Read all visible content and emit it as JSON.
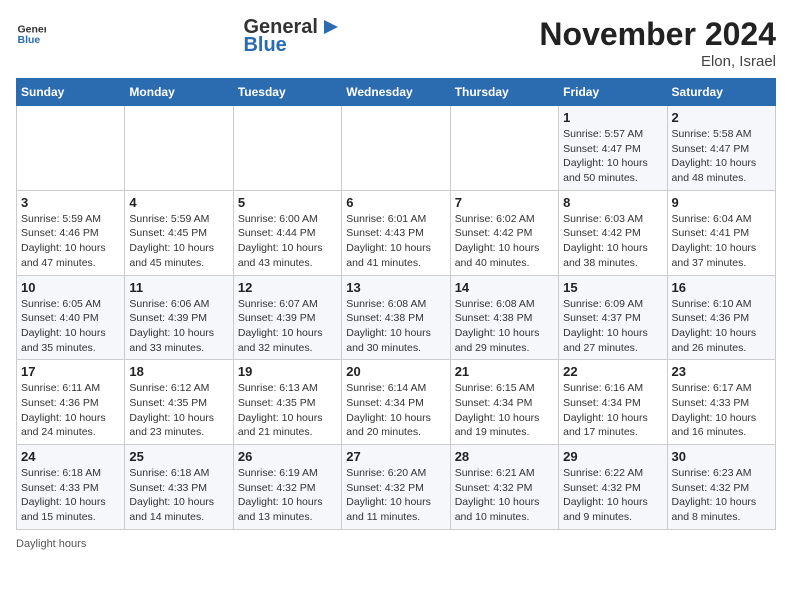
{
  "logo": {
    "general": "General",
    "blue": "Blue"
  },
  "header": {
    "month": "November 2024",
    "location": "Elon, Israel"
  },
  "days_of_week": [
    "Sunday",
    "Monday",
    "Tuesday",
    "Wednesday",
    "Thursday",
    "Friday",
    "Saturday"
  ],
  "weeks": [
    [
      {
        "day": "",
        "info": ""
      },
      {
        "day": "",
        "info": ""
      },
      {
        "day": "",
        "info": ""
      },
      {
        "day": "",
        "info": ""
      },
      {
        "day": "",
        "info": ""
      },
      {
        "day": "1",
        "info": "Sunrise: 5:57 AM\nSunset: 4:47 PM\nDaylight: 10 hours and 50 minutes."
      },
      {
        "day": "2",
        "info": "Sunrise: 5:58 AM\nSunset: 4:47 PM\nDaylight: 10 hours and 48 minutes."
      }
    ],
    [
      {
        "day": "3",
        "info": "Sunrise: 5:59 AM\nSunset: 4:46 PM\nDaylight: 10 hours and 47 minutes."
      },
      {
        "day": "4",
        "info": "Sunrise: 5:59 AM\nSunset: 4:45 PM\nDaylight: 10 hours and 45 minutes."
      },
      {
        "day": "5",
        "info": "Sunrise: 6:00 AM\nSunset: 4:44 PM\nDaylight: 10 hours and 43 minutes."
      },
      {
        "day": "6",
        "info": "Sunrise: 6:01 AM\nSunset: 4:43 PM\nDaylight: 10 hours and 41 minutes."
      },
      {
        "day": "7",
        "info": "Sunrise: 6:02 AM\nSunset: 4:42 PM\nDaylight: 10 hours and 40 minutes."
      },
      {
        "day": "8",
        "info": "Sunrise: 6:03 AM\nSunset: 4:42 PM\nDaylight: 10 hours and 38 minutes."
      },
      {
        "day": "9",
        "info": "Sunrise: 6:04 AM\nSunset: 4:41 PM\nDaylight: 10 hours and 37 minutes."
      }
    ],
    [
      {
        "day": "10",
        "info": "Sunrise: 6:05 AM\nSunset: 4:40 PM\nDaylight: 10 hours and 35 minutes."
      },
      {
        "day": "11",
        "info": "Sunrise: 6:06 AM\nSunset: 4:39 PM\nDaylight: 10 hours and 33 minutes."
      },
      {
        "day": "12",
        "info": "Sunrise: 6:07 AM\nSunset: 4:39 PM\nDaylight: 10 hours and 32 minutes."
      },
      {
        "day": "13",
        "info": "Sunrise: 6:08 AM\nSunset: 4:38 PM\nDaylight: 10 hours and 30 minutes."
      },
      {
        "day": "14",
        "info": "Sunrise: 6:08 AM\nSunset: 4:38 PM\nDaylight: 10 hours and 29 minutes."
      },
      {
        "day": "15",
        "info": "Sunrise: 6:09 AM\nSunset: 4:37 PM\nDaylight: 10 hours and 27 minutes."
      },
      {
        "day": "16",
        "info": "Sunrise: 6:10 AM\nSunset: 4:36 PM\nDaylight: 10 hours and 26 minutes."
      }
    ],
    [
      {
        "day": "17",
        "info": "Sunrise: 6:11 AM\nSunset: 4:36 PM\nDaylight: 10 hours and 24 minutes."
      },
      {
        "day": "18",
        "info": "Sunrise: 6:12 AM\nSunset: 4:35 PM\nDaylight: 10 hours and 23 minutes."
      },
      {
        "day": "19",
        "info": "Sunrise: 6:13 AM\nSunset: 4:35 PM\nDaylight: 10 hours and 21 minutes."
      },
      {
        "day": "20",
        "info": "Sunrise: 6:14 AM\nSunset: 4:34 PM\nDaylight: 10 hours and 20 minutes."
      },
      {
        "day": "21",
        "info": "Sunrise: 6:15 AM\nSunset: 4:34 PM\nDaylight: 10 hours and 19 minutes."
      },
      {
        "day": "22",
        "info": "Sunrise: 6:16 AM\nSunset: 4:34 PM\nDaylight: 10 hours and 17 minutes."
      },
      {
        "day": "23",
        "info": "Sunrise: 6:17 AM\nSunset: 4:33 PM\nDaylight: 10 hours and 16 minutes."
      }
    ],
    [
      {
        "day": "24",
        "info": "Sunrise: 6:18 AM\nSunset: 4:33 PM\nDaylight: 10 hours and 15 minutes."
      },
      {
        "day": "25",
        "info": "Sunrise: 6:18 AM\nSunset: 4:33 PM\nDaylight: 10 hours and 14 minutes."
      },
      {
        "day": "26",
        "info": "Sunrise: 6:19 AM\nSunset: 4:32 PM\nDaylight: 10 hours and 13 minutes."
      },
      {
        "day": "27",
        "info": "Sunrise: 6:20 AM\nSunset: 4:32 PM\nDaylight: 10 hours and 11 minutes."
      },
      {
        "day": "28",
        "info": "Sunrise: 6:21 AM\nSunset: 4:32 PM\nDaylight: 10 hours and 10 minutes."
      },
      {
        "day": "29",
        "info": "Sunrise: 6:22 AM\nSunset: 4:32 PM\nDaylight: 10 hours and 9 minutes."
      },
      {
        "day": "30",
        "info": "Sunrise: 6:23 AM\nSunset: 4:32 PM\nDaylight: 10 hours and 8 minutes."
      }
    ]
  ],
  "footer": {
    "daylight_label": "Daylight hours"
  }
}
